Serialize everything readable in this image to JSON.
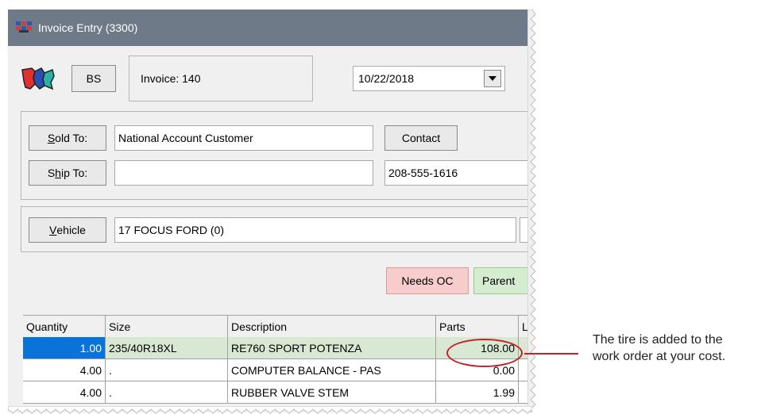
{
  "window": {
    "title": "Invoice Entry (3300)",
    "app_icon": "invoice-app-icon"
  },
  "header_row": {
    "logo": "map-logo-icon",
    "bs_label": "BS",
    "invoice_label": "Invoice: 140",
    "date_value": "10/22/2018"
  },
  "customer": {
    "sold_to_prefix": "",
    "sold_to_underlined": "S",
    "sold_to_rest": "old To:",
    "sold_to_value": "National Account Customer",
    "contact_label": "Contact",
    "ship_to_first": "S",
    "ship_to_underlined": "h",
    "ship_to_rest": "ip To:",
    "ship_to_value": "",
    "phone_value": "208-555-1616"
  },
  "vehicle": {
    "label_underlined": "V",
    "label_rest": "ehicle",
    "value": "17 FOCUS FORD  (0)"
  },
  "badges": {
    "needs_oc": "Needs OC",
    "parent": "Parent"
  },
  "grid": {
    "headers": [
      "Quantity",
      "Size",
      "Description",
      "Parts",
      "L"
    ],
    "rows": [
      [
        "1.00",
        "235/40R18XL",
        "RE760 SPORT POTENZA",
        "108.00"
      ],
      [
        "4.00",
        ".",
        "COMPUTER BALANCE - PAS",
        "0.00"
      ],
      [
        "4.00",
        ".",
        "RUBBER VALVE STEM",
        "1.99"
      ]
    ]
  },
  "callout": {
    "line1": "The tire is added to the",
    "line2": "work order at your cost."
  },
  "colors": {
    "titlebar": "#6e7a87",
    "highlight_red": "#c0212b",
    "selected_row": "#d8e8d2",
    "selected_cell": "#0a73d9",
    "needs_oc_bg": "#f7cccc",
    "parent_bg": "#d6ecd0"
  }
}
